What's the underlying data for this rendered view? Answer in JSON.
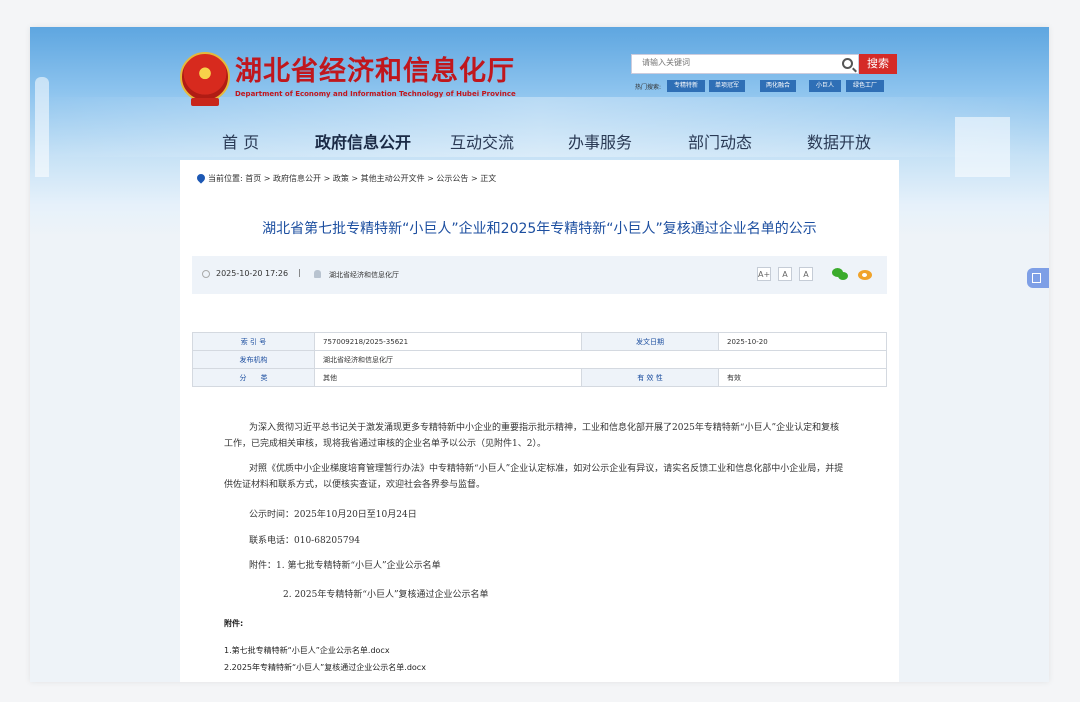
{
  "site": {
    "title": "湖北省经济和信息化厅",
    "subtitle": "Department of Economy and Information Technology of Hubei Province"
  },
  "search": {
    "placeholder": "请输入关键词",
    "button": "搜索",
    "hot_label": "热门搜索:",
    "hot_tags": [
      "专精特新",
      "单项冠军",
      "两化融合",
      "小巨人",
      "绿色工厂"
    ]
  },
  "nav": [
    "首 页",
    "政府信息公开",
    "互动交流",
    "办事服务",
    "部门动态",
    "数据开放"
  ],
  "breadcrumb": {
    "label": "当前位置:",
    "path": "首页 > 政府信息公开 > 政策 > 其他主动公开文件 > 公示公告 > 正文"
  },
  "article": {
    "title": "湖北省第七批专精特新“小巨人”企业和2025年专精特新“小巨人”复核通过企业名单的公示",
    "date": "2025-10-20 17:26",
    "separator": "|",
    "org": "湖北省经济和信息化厅",
    "font_sizes": [
      "A+",
      "A",
      "A"
    ],
    "info": {
      "index_label": "索 引 号",
      "index_value": "757009218/2025-35621",
      "date_label": "发文日期",
      "date_value": "2025-10-20",
      "org_label": "发布机构",
      "org_value": "湖北省经济和信息化厅",
      "category_label": "分　　类",
      "category_value": "其他",
      "validity_label": "有 效 性",
      "validity_value": "有效"
    },
    "para1": "为深入贯彻习近平总书记关于激发涌现更多专精特新中小企业的重要指示批示精神，工业和信息化部开展了2025年专精特新“小巨人”企业认定和复核工作，已完成相关审核，现将我省通过审核的企业名单予以公示（见附件1、2）。",
    "para2": "对照《优质中小企业梯度培育管理暂行办法》中专精特新“小巨人”企业认定标准，如对公示企业有异议，请实名反馈工业和信息化部中小企业局，并提供佐证材料和联系方式，以便核实查证，欢迎社会各界参与监督。",
    "time": "公示时间：2025年10月20日至10月24日",
    "phone": "联系电话：010-68205794",
    "attach1": "附件：1. 第七批专精特新“小巨人”企业公示名单",
    "attach2": "2. 2025年专精特新“小巨人”复核通过企业公示名单",
    "attach_heading": "附件:",
    "files": [
      "1.第七批专精特新“小巨人”企业公示名单.docx",
      "2.2025年专精特新“小巨人”复核通过企业公示名单.docx"
    ]
  }
}
